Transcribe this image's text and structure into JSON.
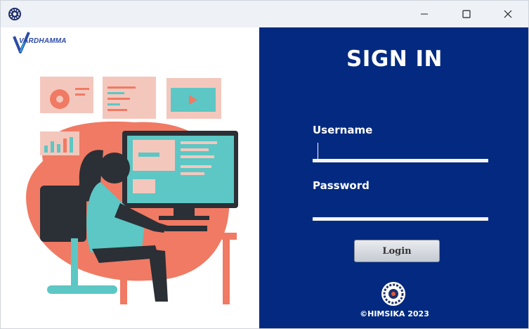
{
  "window": {
    "app_icon": "gear-seal-icon",
    "controls": [
      "minimize-icon",
      "maximize-icon",
      "close-icon"
    ]
  },
  "brand": {
    "logo_text": "VARDHAMMA"
  },
  "form": {
    "title": "SIGN IN",
    "username_label": "Username",
    "username_value": "",
    "password_label": "Password",
    "password_value": "",
    "login_label": "Login"
  },
  "footer": {
    "copyright": "©HIMSIKA 2023",
    "seal_icon": "college-seal-icon"
  },
  "colors": {
    "panel": "#032a80",
    "accent_salmon": "#f07a63",
    "teal": "#5cc7c4"
  }
}
